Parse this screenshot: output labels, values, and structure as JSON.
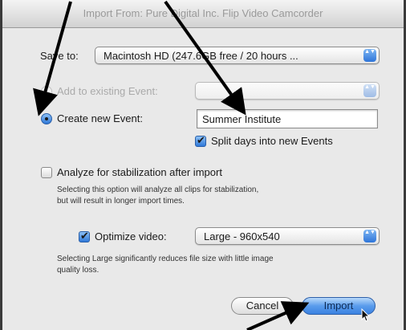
{
  "dialog": {
    "title": "Import From: Pure Digital Inc. Flip Video Camcorder",
    "save_to_label": "Save to:",
    "save_to_value": "Macintosh HD (247.6GB free / 20 hours ...",
    "add_existing_label": "Add to existing Event:",
    "add_existing_value": "",
    "create_new_label": "Create new Event:",
    "new_event_name": "Summer Institute",
    "split_days_label": "Split days into new Events",
    "analyze_label": "Analyze for stabilization after import",
    "analyze_help_line1": "Selecting this option will analyze all clips for stabilization,",
    "analyze_help_line2": "but will result in longer import times.",
    "optimize_label": "Optimize video:",
    "optimize_value": "Large - 960x540",
    "optimize_help_line1": "Selecting Large significantly reduces file size with little image",
    "optimize_help_line2": "quality loss.",
    "cancel_label": "Cancel",
    "import_label": "Import",
    "popup_arrows_glyph": "▲▼"
  },
  "state": {
    "create_new_selected": true,
    "add_existing_selected": false,
    "split_days_checked": true,
    "analyze_checked": false,
    "optimize_checked": true
  },
  "annotation": {
    "arrow_color": "#000000"
  }
}
